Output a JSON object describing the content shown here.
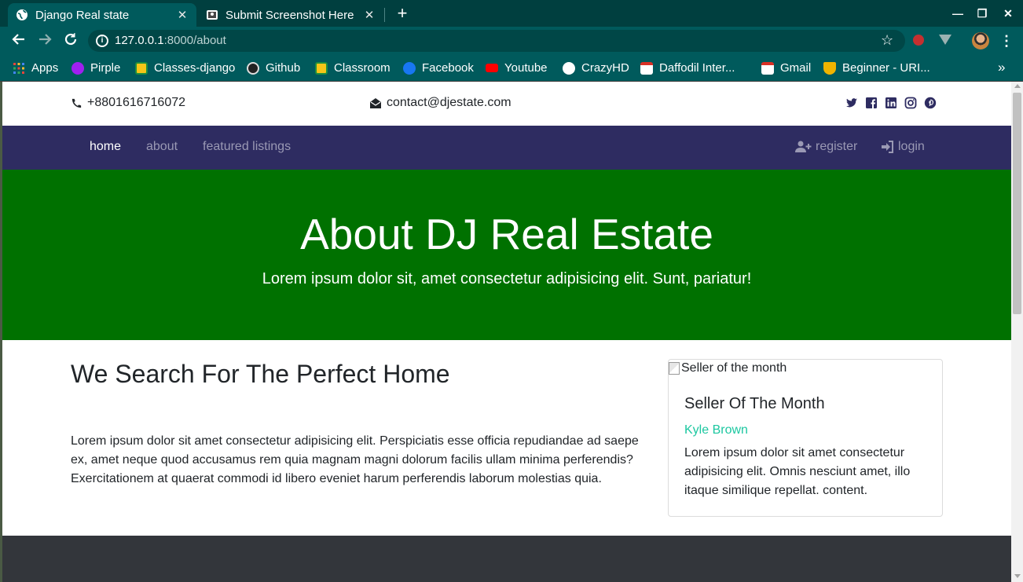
{
  "browser": {
    "tabs": [
      {
        "title": "Django Real state",
        "close": "✕"
      },
      {
        "title": "Submit Screenshot Here",
        "close": "✕"
      }
    ],
    "new_tab": "+",
    "window_controls": {
      "minimize": "—",
      "maximize": "❐",
      "close": "✕"
    },
    "url_host": "127.0.0.1",
    "url_rest": ":8000/about",
    "info_icon": "i",
    "star": "☆",
    "menu": "⋮",
    "bookmarks": [
      {
        "label": "Apps",
        "icon": "apps-grid-icon",
        "color": "#e8453c"
      },
      {
        "label": "Pirple",
        "icon": "pirple-icon",
        "color": "#a020f0"
      },
      {
        "label": "Classes-django",
        "icon": "classroom-icon",
        "color": "#f5c518"
      },
      {
        "label": "Github",
        "icon": "github-icon",
        "color": "#222222"
      },
      {
        "label": "Classroom",
        "icon": "classroom-icon",
        "color": "#f5c518"
      },
      {
        "label": "Facebook",
        "icon": "facebook-icon",
        "color": "#1877f2"
      },
      {
        "label": "Youtube",
        "icon": "youtube-icon",
        "color": "#ff0000"
      },
      {
        "label": "CrazyHD",
        "icon": "globe-icon",
        "color": "#ffffff"
      },
      {
        "label": "Daffodil Inter...",
        "icon": "gmail-icon",
        "color": "#ffffff"
      },
      {
        "label": "Gmail",
        "icon": "gmail-icon",
        "color": "#ffffff"
      },
      {
        "label": "Beginner - URI...",
        "icon": "trophy-icon",
        "color": "#f0b400"
      }
    ],
    "bookmarks_more": "»"
  },
  "site": {
    "phone": "+8801616716072",
    "email": "contact@djestate.com",
    "socials": [
      "twitter-icon",
      "facebook-icon",
      "linkedin-icon",
      "instagram-icon",
      "pinterest-icon"
    ],
    "nav": {
      "home": "home",
      "about": "about",
      "featured": "featured listings",
      "register": "register",
      "login": "login"
    },
    "hero": {
      "title": "About DJ Real Estate",
      "subtitle": "Lorem ipsum dolor sit, amet consectetur adipisicing elit. Sunt, pariatur!"
    },
    "about": {
      "heading": "We Search For The Perfect Home",
      "body": "Lorem ipsum dolor sit amet consectetur adipisicing elit. Perspiciatis esse officia repudiandae ad saepe ex, amet neque quod accusamus rem quia magnam magni dolorum facilis ullam minima perferendis? Exercitationem at quaerat commodi id libero eveniet harum perferendis laborum molestias quia."
    },
    "seller_card": {
      "img_alt": "Seller of the month",
      "title": "Seller Of The Month",
      "name": "Kyle Brown",
      "text": "Lorem ipsum dolor sit amet consectetur adipisicing elit. Omnis nesciunt amet, illo itaque similique repellat. content."
    }
  },
  "colors": {
    "nav_bg": "#2e2c61",
    "hero_bg": "#007100",
    "accent_name": "#1cc7a0",
    "footer_bg": "#33363b",
    "chrome_tab": "#005a5c"
  }
}
